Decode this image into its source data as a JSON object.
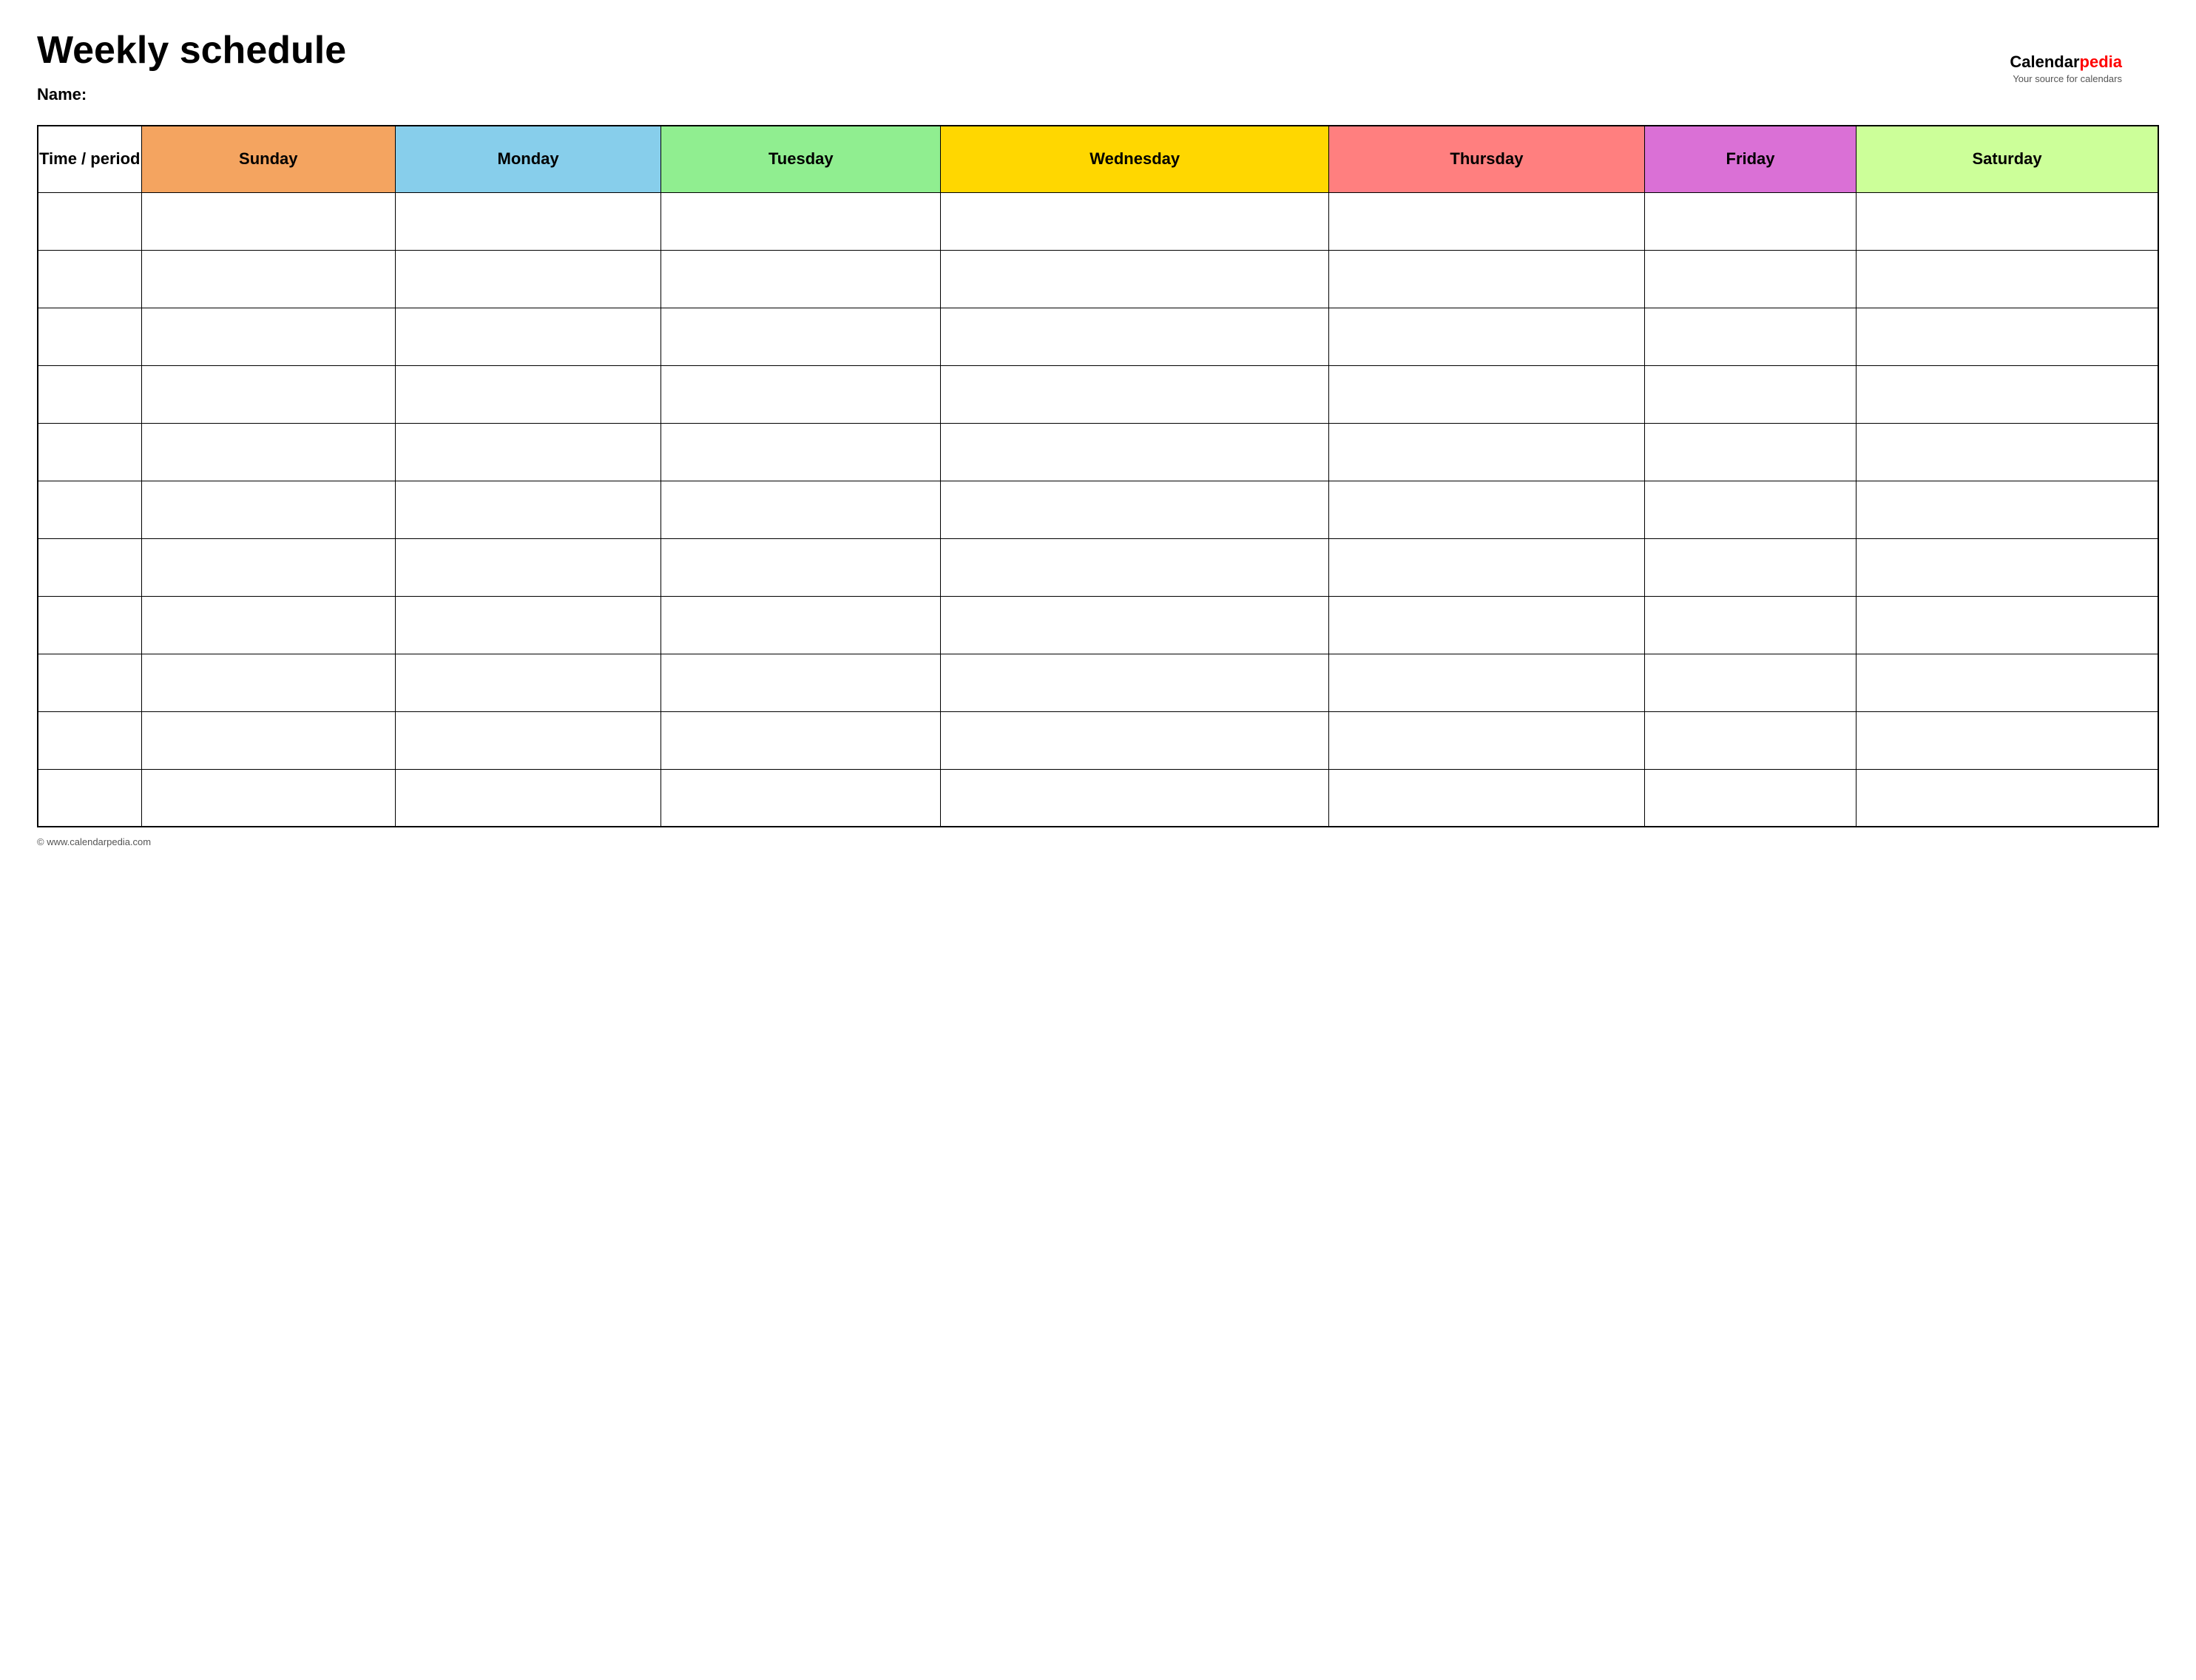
{
  "page": {
    "title": "Weekly schedule",
    "name_label": "Name:",
    "footer_text": "© www.calendarpedia.com"
  },
  "logo": {
    "calendar": "Calendar",
    "pedia": "pedia",
    "tagline": "Your source for calendars"
  },
  "table": {
    "headers": [
      {
        "key": "time",
        "label": "Time / period",
        "color": "#ffffff"
      },
      {
        "key": "sunday",
        "label": "Sunday",
        "color": "#f4a460"
      },
      {
        "key": "monday",
        "label": "Monday",
        "color": "#87ceeb"
      },
      {
        "key": "tuesday",
        "label": "Tuesday",
        "color": "#90ee90"
      },
      {
        "key": "wednesday",
        "label": "Wednesday",
        "color": "#ffd700"
      },
      {
        "key": "thursday",
        "label": "Thursday",
        "color": "#ff7f7f"
      },
      {
        "key": "friday",
        "label": "Friday",
        "color": "#da70d6"
      },
      {
        "key": "saturday",
        "label": "Saturday",
        "color": "#ccff99"
      }
    ],
    "row_count": 11
  }
}
